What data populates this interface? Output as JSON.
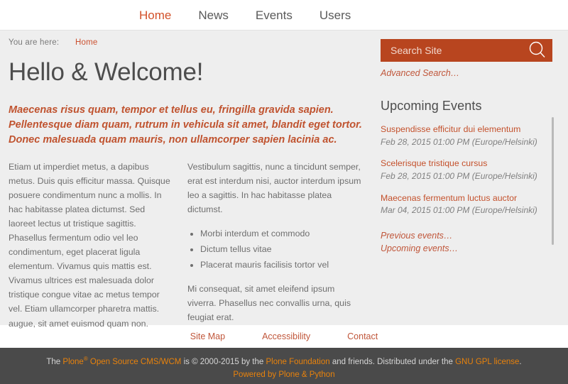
{
  "nav": {
    "items": [
      {
        "label": "Home",
        "current": true
      },
      {
        "label": "News",
        "current": false
      },
      {
        "label": "Events",
        "current": false
      },
      {
        "label": "Users",
        "current": false
      }
    ]
  },
  "breadcrumb": {
    "prefix": "You are here:",
    "home_label": "Home"
  },
  "main": {
    "title": "Hello & Welcome!",
    "lead": "Maecenas risus quam, tempor et tellus eu, fringilla gravida sapien. Pellentesque diam quam, rutrum in vehicula sit amet, blandit eget tortor. Donec malesuada quam mauris, non ullamcorper sapien lacinia ac.",
    "left_column": {
      "paragraph": "Etiam ut imperdiet metus, a dapibus metus. Duis quis efficitur massa. Quisque posuere condimentum nunc a mollis. In hac habitasse platea dictumst. Sed laoreet lectus ut tristique sagittis. Phasellus fermentum odio vel leo condimentum, eget placerat ligula elementum. Vivamus quis mattis est. Vivamus ultrices est malesuada dolor tristique congue vitae ac metus tempor vel. Etiam ullamcorper pharetra mattis.  augue, sit amet euismod quam non."
    },
    "right_column": {
      "paragraph1": "Vestibulum sagittis, nunc a tincidunt semper, erat est interdum nisi, auctor interdum ipsum leo a sagittis. In hac habitasse platea dictumst.",
      "bullets": [
        "Morbi interdum et commodo",
        "Dictum tellus vitae",
        "Placerat mauris facilisis tortor vel"
      ],
      "paragraph2": "Mi consequat, sit amet eleifend ipsum viverra. Phasellus nec convallis urna, quis feugiat erat."
    }
  },
  "sidebar": {
    "search": {
      "placeholder": "Search Site",
      "value": "",
      "icon": "search-icon",
      "background_color": "#b8451f",
      "advanced_label": "Advanced Search…"
    },
    "events_portlet": {
      "title": "Upcoming Events",
      "events": [
        {
          "title": "Suspendisse efficitur dui elementum",
          "date": "Feb 28, 2015 01:00 PM (Europe/Helsinki)"
        },
        {
          "title": "Scelerisque tristique cursus",
          "date": "Feb 28, 2015 01:00 PM (Europe/Helsinki)"
        },
        {
          "title": "Maecenas fermentum luctus auctor",
          "date": "Mar 04, 2015 01:00 PM (Europe/Helsinki)"
        }
      ],
      "footer_links": [
        "Previous events…",
        "Upcoming events…"
      ]
    }
  },
  "footer": {
    "links": [
      "Site Map",
      "Accessibility",
      "Contact"
    ],
    "colophon": {
      "text_the": "The ",
      "plone_link": "Plone",
      "registered": "®",
      "plone_link_tail": " Open Source CMS/WCM",
      "text_is_copyright": " is © 2000-2015 by the ",
      "foundation_link": "Plone Foundation",
      "text_and_friends": " and friends. Distributed under the ",
      "license_link": "GNU GPL license",
      "text_period": ".",
      "powered_by": "Powered by Plone & Python"
    }
  },
  "colors": {
    "accent": "#c0532f",
    "search_bg": "#b8451f",
    "footer_bg": "#4a4a4a",
    "footer_link": "#e8820c",
    "content_bg": "#eeeeee"
  }
}
